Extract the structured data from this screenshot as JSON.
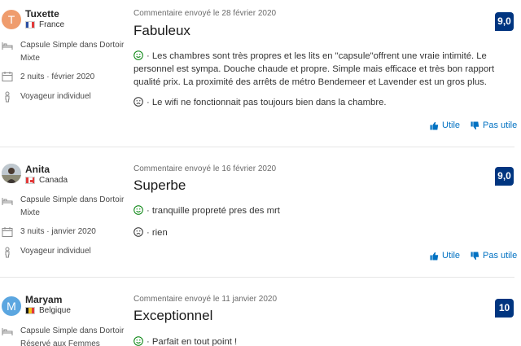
{
  "colors": {
    "brand_blue": "#003580",
    "link_blue": "#0071c2",
    "positive_green": "#008009"
  },
  "reviews": [
    {
      "avatar_letter": "T",
      "avatar_color": "#ef9c6d",
      "name": "Tuxette",
      "country": "France",
      "room": "Capsule Simple dans Dortoir Mixte",
      "stay": "2 nuits ·  février 2020",
      "traveler": "Voyageur individuel",
      "sent_date": "Commentaire envoyé le 28 février 2020",
      "title": "Fabuleux",
      "score": "9,0",
      "positive": "· Les chambres sont très propres et les lits en \"capsule\"offrent une vraie intimité. Le personnel est sympa. Douche chaude et propre. Simple mais efficace et très bon rapport qualité prix. La proximité des arrêts de métro Bendemeer et Lavender est un gros plus.",
      "negative": "· Le wifi ne fonctionnait pas toujours bien dans la chambre.",
      "helpful": "Utile",
      "not_helpful": "Pas utile"
    },
    {
      "avatar_letter": "",
      "avatar_color": "#c9c4bd",
      "name": "Anita",
      "country": "Canada",
      "room": "Capsule Simple dans Dortoir Mixte",
      "stay": "3 nuits ·  janvier 2020",
      "traveler": "Voyageur individuel",
      "sent_date": "Commentaire envoyé le 16 février 2020",
      "title": "Superbe",
      "score": "9,0",
      "positive": "· tranquille propreté pres des mrt",
      "negative": "· rien",
      "helpful": "Utile",
      "not_helpful": "Pas utile"
    },
    {
      "avatar_letter": "M",
      "avatar_color": "#5ba6e0",
      "name": "Maryam",
      "country": "Belgique",
      "room": "Capsule Simple dans Dortoir Réservé aux Femmes",
      "sent_date": "Commentaire envoyé le 11 janvier 2020",
      "title": "Exceptionnel",
      "score": "10",
      "positive": "· Parfait en tout point !"
    }
  ]
}
